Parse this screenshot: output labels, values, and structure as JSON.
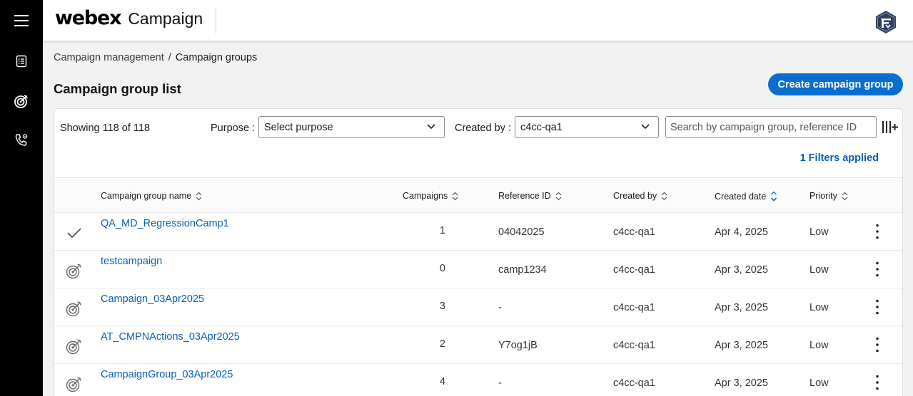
{
  "app": {
    "brand": "webex",
    "product": "Campaign"
  },
  "nav": {
    "items": [
      {
        "name": "menu-icon"
      },
      {
        "name": "list-icon"
      },
      {
        "name": "target-icon"
      },
      {
        "name": "phone-settings-icon"
      }
    ]
  },
  "breadcrumb": {
    "parent": "Campaign management",
    "separator": "/",
    "current": "Campaign groups"
  },
  "page": {
    "title": "Campaign group list",
    "create_label": "Create campaign group"
  },
  "toolbar": {
    "showing": "Showing 118 of 118",
    "purpose_label": "Purpose :",
    "purpose_value": "Select purpose",
    "created_by_label": "Created by :",
    "created_by_value": "c4cc-qa1",
    "search_placeholder": "Search by campaign group, reference ID",
    "filters_applied": "1 Filters applied"
  },
  "table": {
    "columns": {
      "name": "Campaign group name",
      "campaigns": "Campaigns",
      "reference_id": "Reference ID",
      "created_by": "Created by",
      "created_date": "Created date",
      "priority": "Priority"
    },
    "rows": [
      {
        "status": "check",
        "name": "QA_MD_RegressionCamp1",
        "campaigns": "1",
        "reference_id": "04042025",
        "created_by": "c4cc-qa1",
        "created_date": "Apr 4, 2025",
        "priority": "Low"
      },
      {
        "status": "target",
        "name": "testcampaign",
        "campaigns": "0",
        "reference_id": "camp1234",
        "created_by": "c4cc-qa1",
        "created_date": "Apr 3, 2025",
        "priority": "Low"
      },
      {
        "status": "target",
        "name": "Campaign_03Apr2025",
        "campaigns": "3",
        "reference_id": "-",
        "created_by": "c4cc-qa1",
        "created_date": "Apr 3, 2025",
        "priority": "Low"
      },
      {
        "status": "target",
        "name": "AT_CMPNActions_03Apr2025",
        "campaigns": "2",
        "reference_id": "Y7og1jB",
        "created_by": "c4cc-qa1",
        "created_date": "Apr 3, 2025",
        "priority": "Low"
      },
      {
        "status": "target",
        "name": "CampaignGroup_03Apr2025",
        "campaigns": "4",
        "reference_id": "-",
        "created_by": "c4cc-qa1",
        "created_date": "Apr 3, 2025",
        "priority": "Low"
      }
    ]
  },
  "colors": {
    "accent": "#0a6ed1",
    "link": "#0a5fb4",
    "nav_bg": "#000000"
  }
}
